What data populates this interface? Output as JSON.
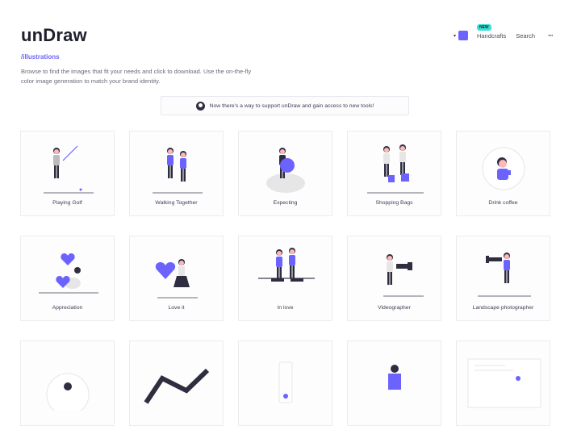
{
  "brand": {
    "name": "unDraw",
    "section": "/illustrations"
  },
  "description": "Browse to find the images that fit your needs and click to download. Use the on-the-fly color image generation to match your brand identity.",
  "nav": {
    "color_caret": "▾",
    "accent_color": "#6c63ff",
    "badge": "NEW",
    "badge_color": "#38e0d3",
    "handcrafts": "Handcrafts",
    "search": "Search",
    "more": "···"
  },
  "support_banner": {
    "text": "Now there's a way to support unDraw and gain access to new tools!"
  },
  "illustrations": [
    {
      "title": "Playing Golf"
    },
    {
      "title": "Walking Together"
    },
    {
      "title": "Expecting"
    },
    {
      "title": "Shopping Bags"
    },
    {
      "title": "Drink coffee"
    },
    {
      "title": "Appreciation"
    },
    {
      "title": "Love it"
    },
    {
      "title": "In love"
    },
    {
      "title": "Videographer"
    },
    {
      "title": "Landscape photographer"
    },
    {
      "title": ""
    },
    {
      "title": ""
    },
    {
      "title": ""
    },
    {
      "title": ""
    },
    {
      "title": ""
    }
  ]
}
